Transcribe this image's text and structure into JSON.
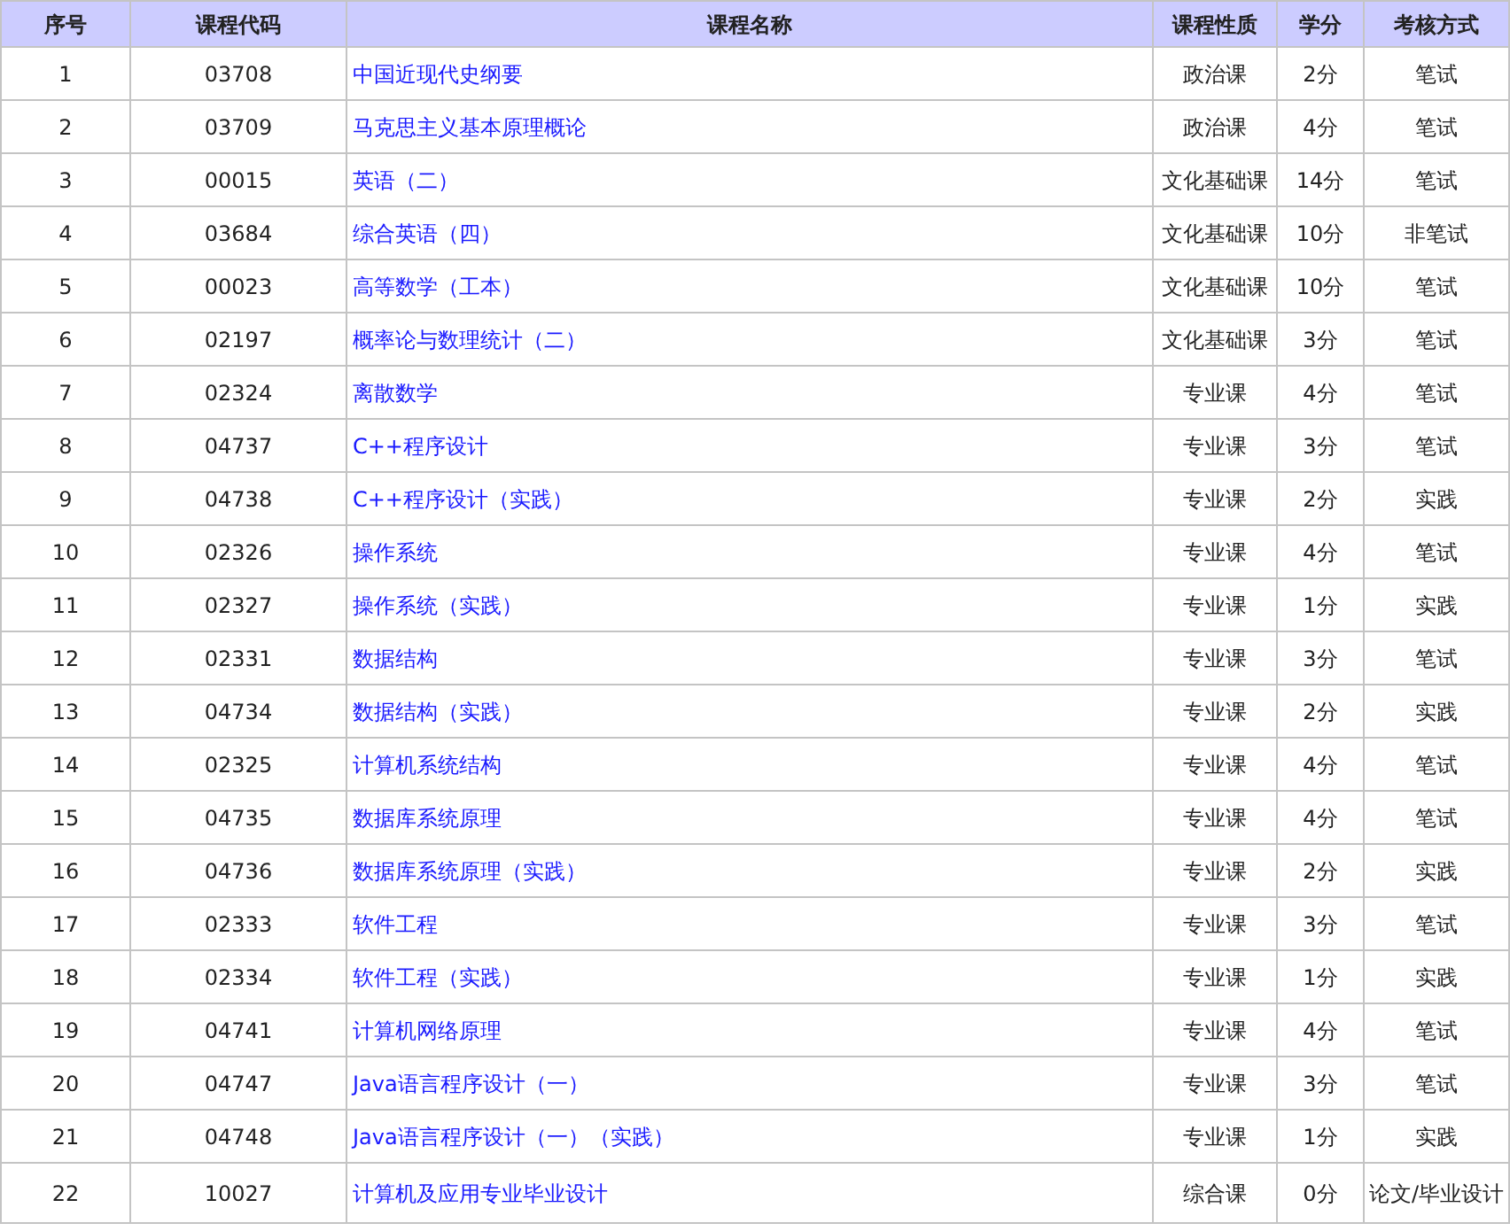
{
  "table": {
    "columns": [
      "序号",
      "课程代码",
      "课程名称",
      "课程性质",
      "学分",
      "考核方式"
    ],
    "rows": [
      {
        "no": "1",
        "code": "03708",
        "name": "中国近现代史纲要",
        "type": "政治课",
        "credits": "2分",
        "exam": "笔试"
      },
      {
        "no": "2",
        "code": "03709",
        "name": "马克思主义基本原理概论",
        "type": "政治课",
        "credits": "4分",
        "exam": "笔试"
      },
      {
        "no": "3",
        "code": "00015",
        "name": "英语（二）",
        "type": "文化基础课",
        "credits": "14分",
        "exam": "笔试"
      },
      {
        "no": "4",
        "code": "03684",
        "name": "综合英语（四）",
        "type": "文化基础课",
        "credits": "10分",
        "exam": "非笔试"
      },
      {
        "no": "5",
        "code": "00023",
        "name": "高等数学（工本）",
        "type": "文化基础课",
        "credits": "10分",
        "exam": "笔试"
      },
      {
        "no": "6",
        "code": "02197",
        "name": "概率论与数理统计（二）",
        "type": "文化基础课",
        "credits": "3分",
        "exam": "笔试"
      },
      {
        "no": "7",
        "code": "02324",
        "name": "离散数学",
        "type": "专业课",
        "credits": "4分",
        "exam": "笔试"
      },
      {
        "no": "8",
        "code": "04737",
        "name": "C++程序设计",
        "type": "专业课",
        "credits": "3分",
        "exam": "笔试"
      },
      {
        "no": "9",
        "code": "04738",
        "name": "C++程序设计（实践）",
        "type": "专业课",
        "credits": "2分",
        "exam": "实践"
      },
      {
        "no": "10",
        "code": "02326",
        "name": "操作系统",
        "type": "专业课",
        "credits": "4分",
        "exam": "笔试"
      },
      {
        "no": "11",
        "code": "02327",
        "name": "操作系统（实践）",
        "type": "专业课",
        "credits": "1分",
        "exam": "实践"
      },
      {
        "no": "12",
        "code": "02331",
        "name": "数据结构",
        "type": "专业课",
        "credits": "3分",
        "exam": "笔试"
      },
      {
        "no": "13",
        "code": "04734",
        "name": "数据结构（实践）",
        "type": "专业课",
        "credits": "2分",
        "exam": "实践"
      },
      {
        "no": "14",
        "code": "02325",
        "name": "计算机系统结构",
        "type": "专业课",
        "credits": "4分",
        "exam": "笔试"
      },
      {
        "no": "15",
        "code": "04735",
        "name": "数据库系统原理",
        "type": "专业课",
        "credits": "4分",
        "exam": "笔试"
      },
      {
        "no": "16",
        "code": "04736",
        "name": "数据库系统原理（实践）",
        "type": "专业课",
        "credits": "2分",
        "exam": "实践"
      },
      {
        "no": "17",
        "code": "02333",
        "name": "软件工程",
        "type": "专业课",
        "credits": "3分",
        "exam": "笔试"
      },
      {
        "no": "18",
        "code": "02334",
        "name": "软件工程（实践）",
        "type": "专业课",
        "credits": "1分",
        "exam": "实践"
      },
      {
        "no": "19",
        "code": "04741",
        "name": "计算机网络原理",
        "type": "专业课",
        "credits": "4分",
        "exam": "笔试"
      },
      {
        "no": "20",
        "code": "04747",
        "name": "Java语言程序设计（一）",
        "type": "专业课",
        "credits": "3分",
        "exam": "笔试"
      },
      {
        "no": "21",
        "code": "04748",
        "name": "Java语言程序设计（一）（实践）",
        "type": "专业课",
        "credits": "1分",
        "exam": "实践"
      },
      {
        "no": "22",
        "code": "10027",
        "name": "计算机及应用专业毕业设计",
        "type": "综合课",
        "credits": "0分",
        "exam": "论文/毕业设计"
      }
    ]
  }
}
